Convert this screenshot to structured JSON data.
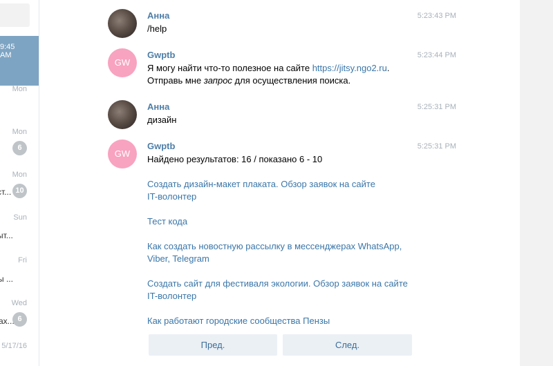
{
  "sidebar": {
    "active_time": "9:45 AM",
    "dialogs": [
      {
        "date": "Mon",
        "badge": "",
        "text": ""
      },
      {
        "date": "Mon",
        "badge": "6",
        "text": ""
      },
      {
        "date": "Mon",
        "badge": "10",
        "text": "ст..."
      },
      {
        "date": "Sun",
        "badge": "",
        "text": "ыт..."
      },
      {
        "date": "Fri",
        "badge": "",
        "text": "ы ..."
      },
      {
        "date": "Wed",
        "badge": "6",
        "text": "ах..."
      },
      {
        "date": "5/17/16",
        "badge": "",
        "text": ""
      }
    ]
  },
  "messages": [
    {
      "author": "Анна",
      "time": "5:23:43 PM",
      "text": "/help"
    },
    {
      "author": "Gwptb",
      "avatar_initials": "GW",
      "time": "5:23:44 PM",
      "line1_prefix": "Я могу найти что-то полезное на сайте ",
      "line1_link": "https://jitsy.ngo2.ru",
      "line1_suffix": ".",
      "line2_prefix": "Отправь мне ",
      "line2_em": "запрос",
      "line2_suffix": " для осуществления поиска."
    },
    {
      "author": "Анна",
      "time": "5:25:31 PM",
      "text": "дизайн"
    },
    {
      "author": "Gwptb",
      "avatar_initials": "GW",
      "time": "5:25:31 PM",
      "summary": "Найдено результатов: 16 / показано 6 - 10",
      "results": [
        {
          "line1": "Создать дизайн-макет плаката. Обзор заявок на сайте",
          "line2": "IT-волонтер"
        },
        {
          "line1": "Тест кода",
          "line2": ""
        },
        {
          "line1": "Как создать новостную рассылку в мессенджерах WhatsApp,",
          "line2": "Viber, Telegram"
        },
        {
          "line1": "Создать сайт для фестиваля экологии. Обзор заявок на сайте",
          "line2": "IT-волонтер"
        },
        {
          "line1": "Как работают городские сообщества Пензы",
          "line2": ""
        }
      ]
    }
  ],
  "keyboard": {
    "prev_label": "Пред.",
    "next_label": "След."
  },
  "colors": {
    "accent": "#4e7ea8",
    "link": "#3a76a8",
    "active_dialog": "#7ea4c3",
    "bot_avatar": "#f8a3c0"
  }
}
